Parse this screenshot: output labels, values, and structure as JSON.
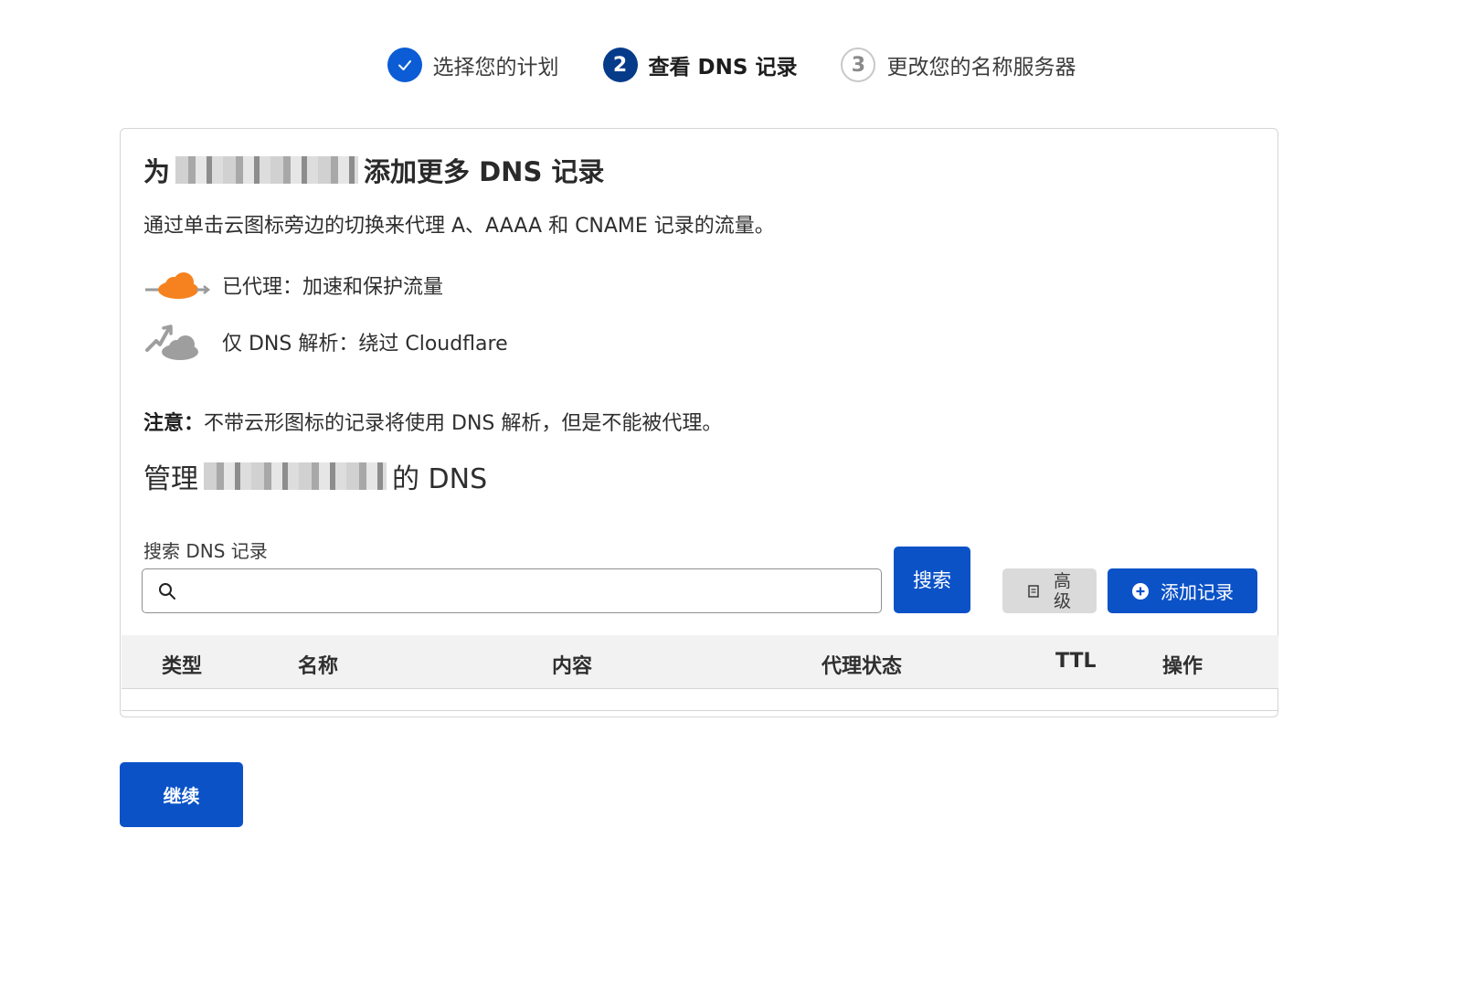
{
  "stepper": {
    "steps": [
      {
        "number": "✓",
        "label": "选择您的计划",
        "state": "done"
      },
      {
        "number": "2",
        "label": "查看 DNS 记录",
        "state": "current"
      },
      {
        "number": "3",
        "label": "更改您的名称服务器",
        "state": "todo"
      }
    ]
  },
  "card": {
    "title_prefix": "为",
    "title_suffix": "添加更多 DNS 记录",
    "description": "通过单击云图标旁边的切换来代理 A、AAAA 和 CNAME 记录的流量。",
    "legend": {
      "proxied": "已代理：加速和保护流量",
      "dns_only": "仅 DNS 解析：绕过 Cloudflare"
    },
    "note_label": "注意：",
    "note_text": "不带云形图标的记录将使用 DNS 解析，但是不能被代理。",
    "manage_prefix": "管理",
    "manage_suffix": "的 DNS",
    "search": {
      "label": "搜索 DNS 记录",
      "value": "",
      "button": "搜索"
    },
    "advanced_button": "高级",
    "add_record_button": "添加记录",
    "table": {
      "columns": [
        "类型",
        "名称",
        "内容",
        "代理状态",
        "TTL",
        "操作"
      ]
    }
  },
  "continue_button": "继续",
  "colors": {
    "primary": "#0b52c7",
    "step_current": "#063b8a",
    "proxied_orange": "#f6821f",
    "dns_only_gray": "#9e9e9e"
  }
}
